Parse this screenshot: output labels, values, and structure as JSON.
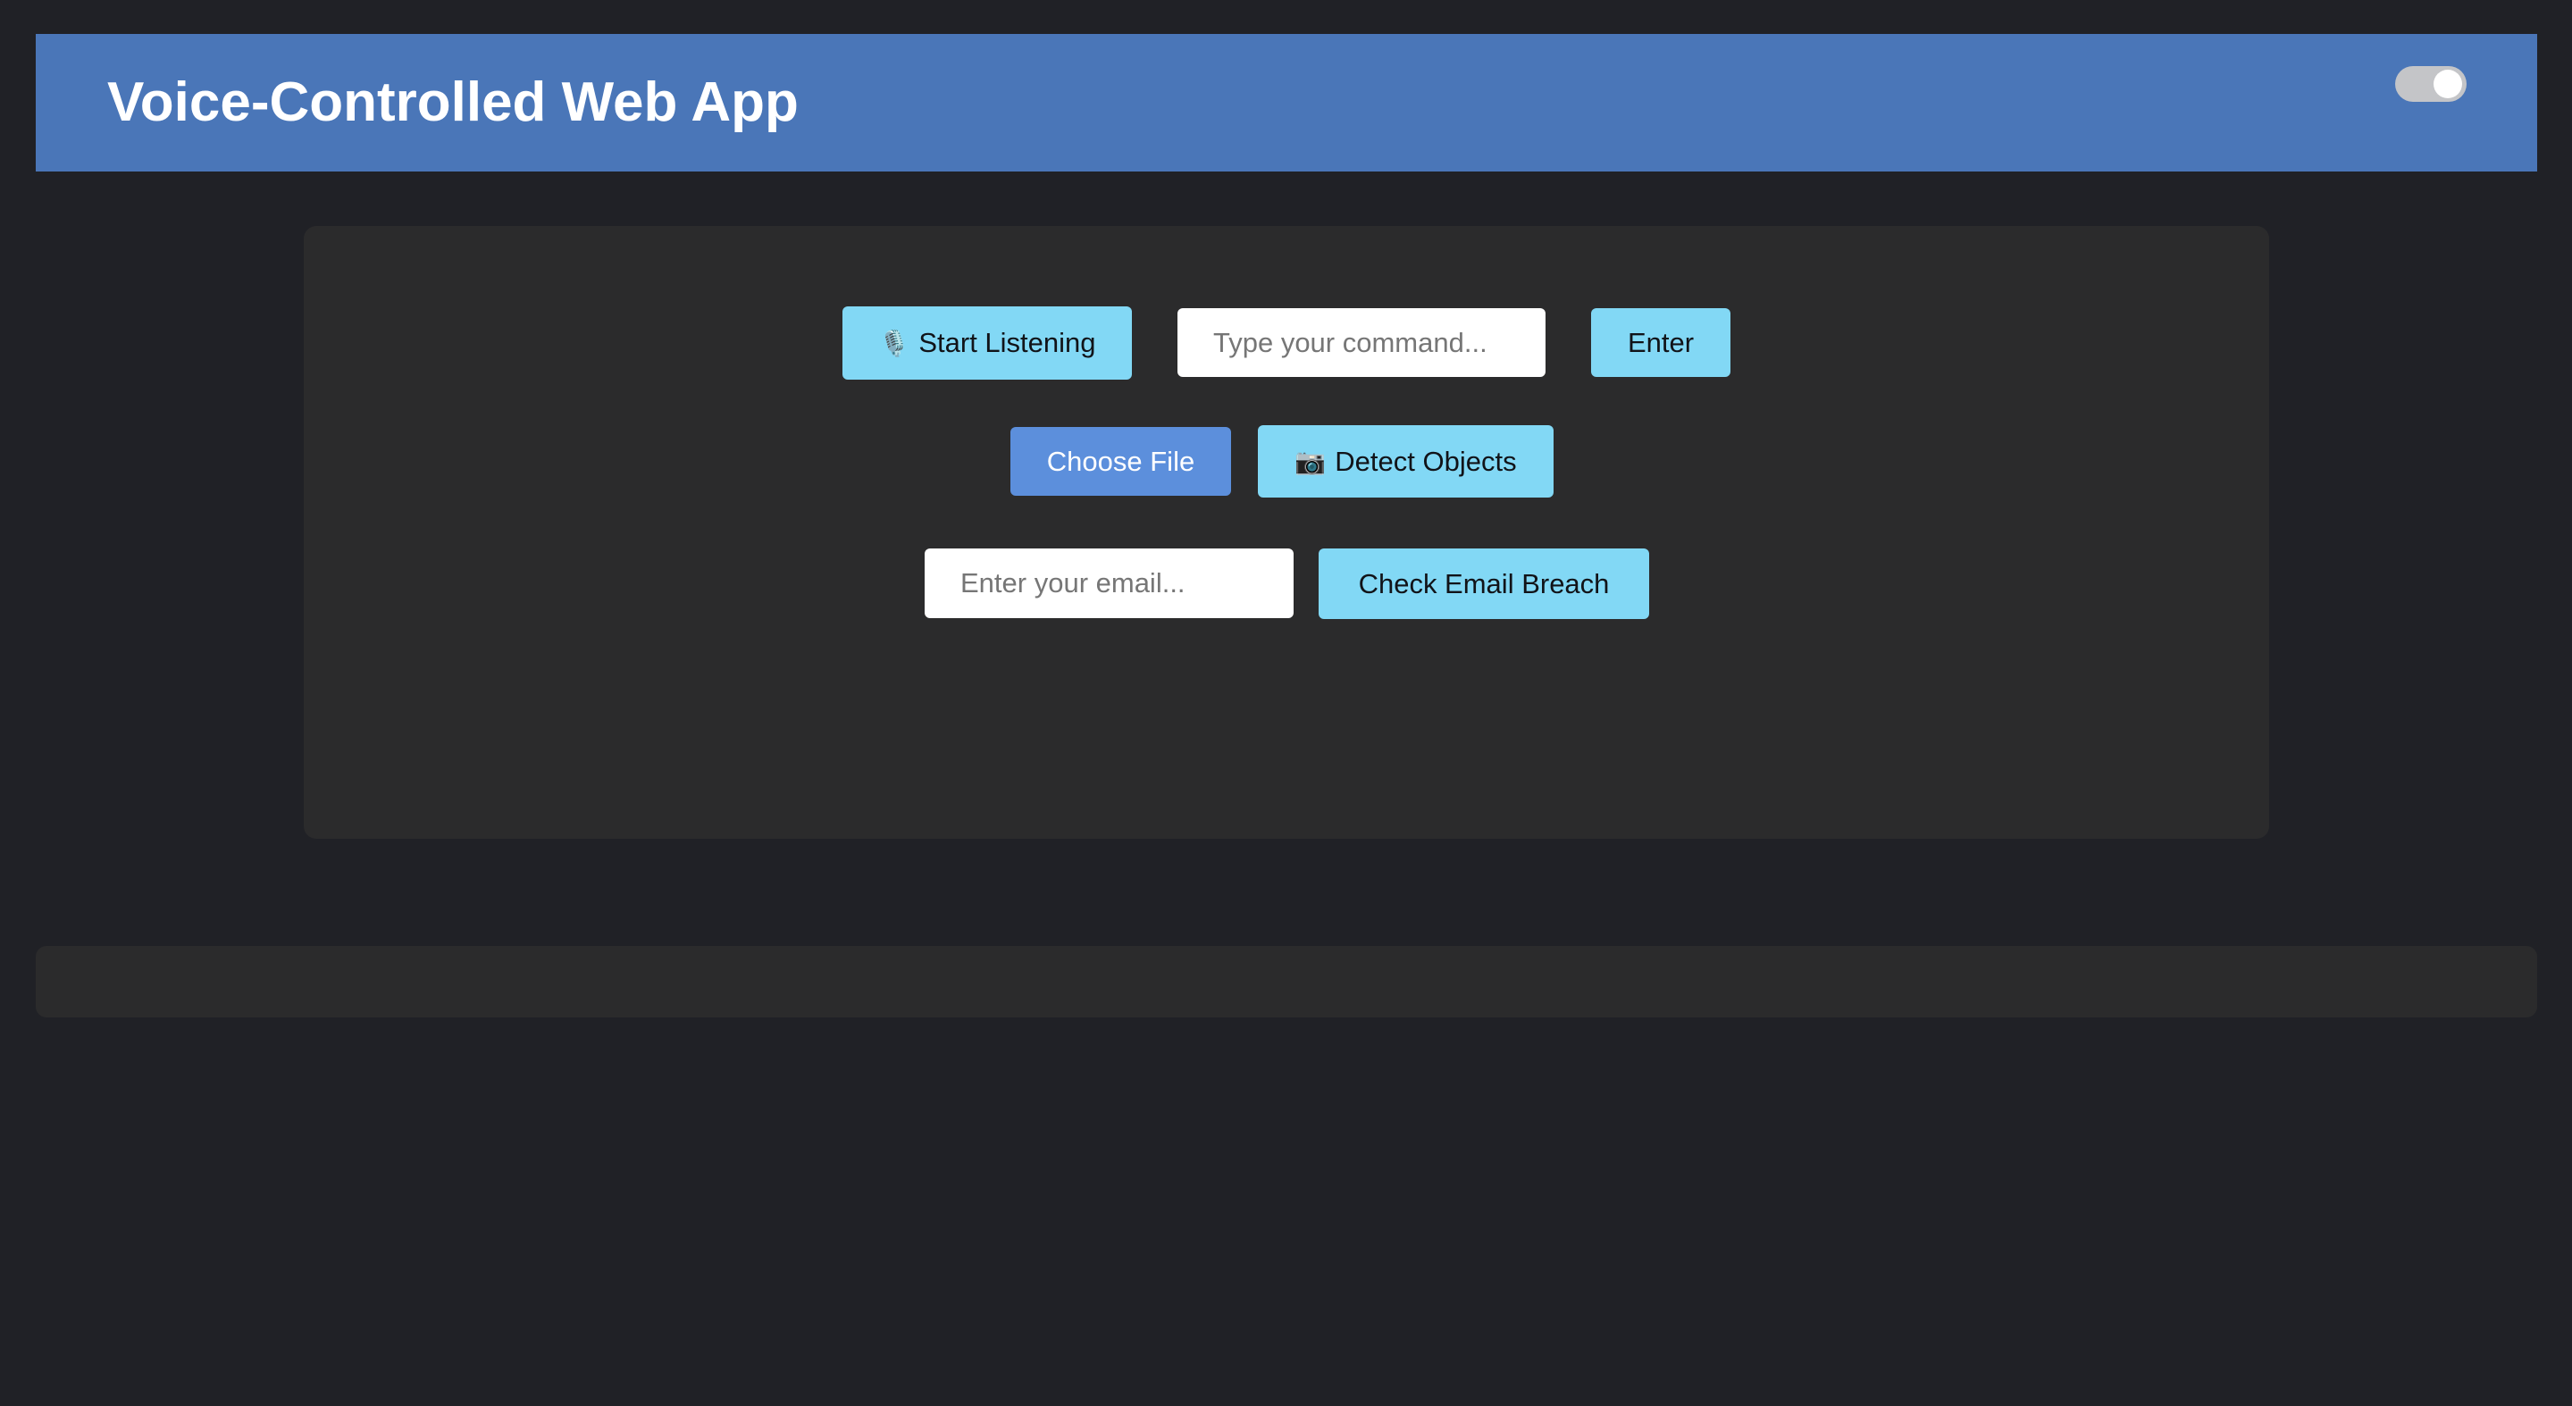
{
  "header": {
    "title": "Voice-Controlled Web App",
    "theme_toggle_state": "on"
  },
  "main": {
    "voice": {
      "start_label": "Start Listening",
      "start_icon": "microphone-icon",
      "command_placeholder": "Type your command...",
      "command_value": "",
      "enter_label": "Enter"
    },
    "vision": {
      "choose_file_label": "Choose File",
      "detect_label": "Detect Objects",
      "detect_icon": "camera-icon"
    },
    "breach": {
      "email_placeholder": "Enter your email...",
      "email_value": "",
      "check_label": "Check Email Breach"
    }
  },
  "colors": {
    "page_background": "#202126",
    "header_background": "#4a76b8",
    "panel_background": "#2b2b2c",
    "button_accent": "#82d8f5",
    "choose_file_background": "#5c8fdc"
  }
}
